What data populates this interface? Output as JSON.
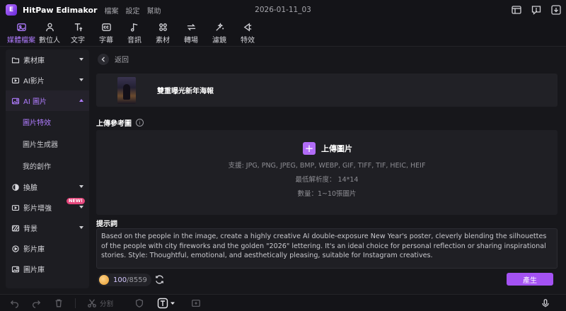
{
  "app": {
    "name": "HitPaw Edimakor",
    "menu": [
      "檔案",
      "設定",
      "幫助"
    ],
    "project_title": "2026-01-11_03"
  },
  "toolbar": {
    "items": [
      {
        "label": "媒體檔案",
        "icon": "media-icon",
        "active": true
      },
      {
        "label": "數位人",
        "icon": "avatar-person-icon",
        "active": false
      },
      {
        "label": "文字",
        "icon": "text-icon",
        "active": false
      },
      {
        "label": "字幕",
        "icon": "subtitle-icon",
        "active": false
      },
      {
        "label": "音訊",
        "icon": "music-note-icon",
        "active": false
      },
      {
        "label": "素材",
        "icon": "elements-icon",
        "active": false
      },
      {
        "label": "轉場",
        "icon": "transition-icon",
        "active": false
      },
      {
        "label": "濾鏡",
        "icon": "filter-icon",
        "active": false
      },
      {
        "label": "特效",
        "icon": "effects-icon",
        "active": false
      }
    ]
  },
  "sidebar": {
    "items": [
      {
        "label": "素材庫",
        "icon": "folder-icon"
      },
      {
        "label": "AI影片",
        "icon": "ai-video-icon"
      },
      {
        "label": "AI 圖片",
        "icon": "ai-image-icon",
        "expanded": true
      },
      {
        "label": "換臉",
        "icon": "face-swap-icon"
      },
      {
        "label": "影片增強",
        "icon": "video-enhance-icon",
        "badge": "NEW!"
      },
      {
        "label": "背景",
        "icon": "background-icon"
      },
      {
        "label": "影片庫",
        "icon": "video-library-icon"
      },
      {
        "label": "圖片庫",
        "icon": "image-library-icon"
      }
    ],
    "subitems": [
      {
        "label": "圖片特效",
        "active": true
      },
      {
        "label": "圖片生成器",
        "active": false
      },
      {
        "label": "我的創作",
        "active": false
      }
    ]
  },
  "main": {
    "back_label": "返回",
    "template_name": "雙重曝光新年海報",
    "upload_section_label": "上傳參考圖",
    "upload_button_label": "上傳圖片",
    "upload_formats": "支援: JPG, PNG, JPEG, BMP, WEBP, GIF, TIFF, TIF, HEIC, HEIF",
    "upload_min_resolution": "最低解析度： 14*14",
    "upload_count": "數量：1~10張圖片",
    "prompt_label": "提示詞",
    "prompt_text": "Based on the people in the image, create a highly creative AI double-exposure New Year's poster, cleverly blending the silhouettes of the people with city fireworks and the golden \"2026\" lettering. It's an ideal choice for personal reflection or sharing inspirational stories. Style: Thoughtful, emotional, and aesthetically pleasing, suitable for Instagram creatives.",
    "credits_used": "100",
    "credits_total": "/8559",
    "generate_label": "產生"
  },
  "bottombar": {
    "split_label": "分割"
  },
  "colors": {
    "accent": "#b07cff",
    "generate_button": "#a452f3",
    "background": "#17171b"
  }
}
